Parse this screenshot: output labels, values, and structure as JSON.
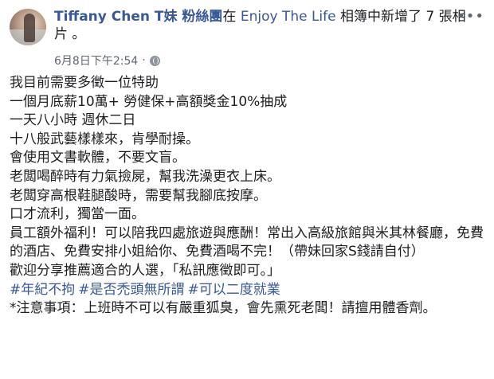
{
  "post": {
    "author": "Tiffany Chen T妹 粉絲團",
    "action_prefix": "在 ",
    "album": "Enjoy The Life",
    "action_suffix": " 相簿中新增了 7 張相片 。",
    "timestamp": "6月8日下午2:54",
    "separator": "·",
    "more_icon_glyph": "•••",
    "privacy_icon": "globe-icon"
  },
  "body_lines": [
    "我目前需要多徵一位特助",
    "一個月底薪10萬+ 勞健保+高額獎金10%抽成",
    "一天八小時 週休二日",
    "十八般武藝樣樣來，肯學耐操。",
    "會使用文書軟體，不要文盲。",
    "老闆喝醉時有力氣撿屍，幫我洗澡更衣上床。",
    "老闆穿高根鞋腿酸時，需要幫我腳底按摩。",
    "口才流利，獨當一面。",
    "員工額外福利！可以陪我四處旅遊與應酬！常出入高級旅館與米其林餐廳，免費的酒店、免費安排小姐給你、免費酒喝不完！（帶妹回家S錢請自付）",
    "歡迎分享推薦適合的人選，「私訊應徵即可。」"
  ],
  "hashtags": [
    "#年紀不拘",
    "#是否禿頭無所謂",
    "#可以二度就業"
  ],
  "note": "*注意事項：上班時不可以有嚴重狐臭，會先熏死老闆！請擅用體香劑。",
  "colors": {
    "link": "#385898",
    "text": "#1c1e21",
    "meta": "#606770"
  }
}
